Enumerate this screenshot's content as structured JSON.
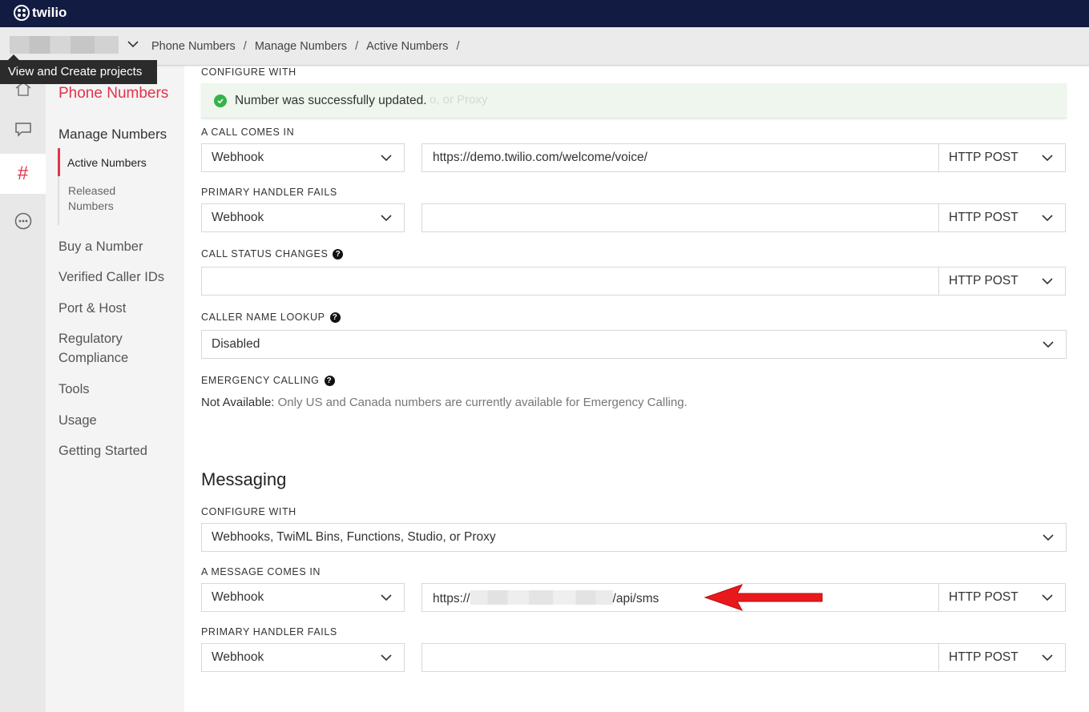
{
  "brand": {
    "name": "twilio"
  },
  "breadcrumb": {
    "items": [
      "Phone Numbers",
      "Manage Numbers",
      "Active Numbers"
    ],
    "separator": "/"
  },
  "tooltip": {
    "text": "View and Create projects"
  },
  "rail": {
    "icons": [
      "home-icon",
      "chat-icon",
      "hash-icon",
      "more-icon"
    ]
  },
  "sidebar": {
    "title": "Phone Numbers",
    "section": "Manage Numbers",
    "subitems": [
      "Active Numbers",
      "Released Numbers"
    ],
    "links": [
      "Buy a Number",
      "Verified Caller IDs",
      "Port & Host",
      "Regulatory Compliance",
      "Tools",
      "Usage",
      "Getting Started"
    ]
  },
  "voice": {
    "configure_label": "CONFIGURE WITH",
    "toast": "Number was successfully updated.",
    "toast_ghost": "o, or Proxy",
    "call_in_label": "A CALL COMES IN",
    "call_in_type": "Webhook",
    "call_in_url": "https://demo.twilio.com/welcome/voice/",
    "call_in_method": "HTTP POST",
    "fail_label": "PRIMARY HANDLER FAILS",
    "fail_type": "Webhook",
    "fail_url": "",
    "fail_method": "HTTP POST",
    "status_label": "CALL STATUS CHANGES",
    "status_url": "",
    "status_method": "HTTP POST",
    "lookup_label": "CALLER NAME LOOKUP",
    "lookup_value": "Disabled",
    "emergency_label": "EMERGENCY CALLING",
    "emergency_prefix": "Not Available:",
    "emergency_text": "Only US and Canada numbers are currently available for Emergency Calling."
  },
  "messaging": {
    "title": "Messaging",
    "configure_label": "CONFIGURE WITH",
    "configure_value": "Webhooks, TwiML Bins, Functions, Studio, or Proxy",
    "msg_in_label": "A MESSAGE COMES IN",
    "msg_in_type": "Webhook",
    "msg_in_url_prefix": "https://",
    "msg_in_url_suffix": "/api/sms",
    "msg_in_method": "HTTP POST",
    "fail_label": "PRIMARY HANDLER FAILS",
    "fail_type": "Webhook",
    "fail_url": "",
    "fail_method": "HTTP POST"
  },
  "colors": {
    "topbar": "#121c42",
    "accent": "#e2334a",
    "success": "#36b24a",
    "annotation_arrow": "#e8191c"
  }
}
